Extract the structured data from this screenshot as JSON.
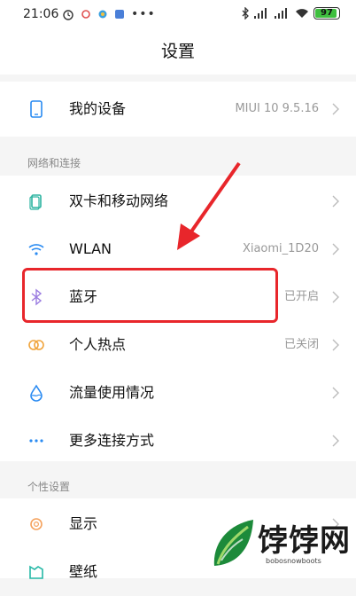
{
  "status_bar": {
    "time": "21:06",
    "battery_level": "97",
    "icons": [
      "alarm-icon",
      "app-icon",
      "app-icon",
      "app-icon",
      "more-icon",
      "bluetooth-icon",
      "signal-icon",
      "signal-icon",
      "wifi-icon",
      "battery-icon"
    ]
  },
  "header": {
    "title": "设置"
  },
  "rows": {
    "my_device": {
      "label": "我的设备",
      "value": "MIUI 10 9.5.16"
    },
    "dual_sim": {
      "label": "双卡和移动网络"
    },
    "wlan": {
      "label": "WLAN",
      "value": "Xiaomi_1D20"
    },
    "bluetooth": {
      "label": "蓝牙",
      "value": "已开启"
    },
    "hotspot": {
      "label": "个人热点",
      "value": "已关闭"
    },
    "data_usage": {
      "label": "流量使用情况"
    },
    "more_connections": {
      "label": "更多连接方式"
    },
    "display": {
      "label": "显示"
    },
    "wallpaper": {
      "label": "壁纸"
    }
  },
  "sections": {
    "network": "网络和连接",
    "personal": "个性设置"
  },
  "watermark": {
    "name": "饽饽网",
    "sub": "bobosnowboots"
  },
  "colors": {
    "accent_blue": "#2a8bf2",
    "annotation_red": "#e8262b",
    "hotspot_orange": "#f0a43c",
    "display_orange": "#f5a25d",
    "wallpaper_teal": "#25b8a6"
  }
}
